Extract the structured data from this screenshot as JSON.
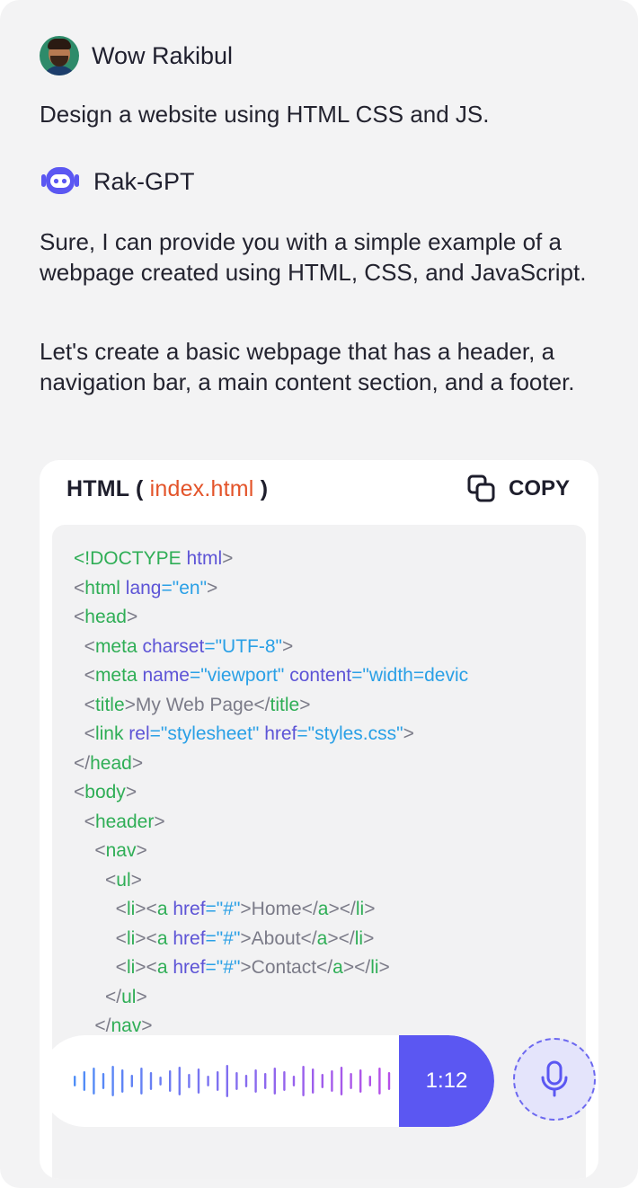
{
  "user": {
    "name": "Wow Rakibul",
    "message": "Design a website using HTML CSS and JS."
  },
  "bot": {
    "name": "Rak-GPT",
    "message_1": "Sure, I can provide you with a simple example of a webpage created using HTML, CSS, and JavaScript.",
    "message_2": "Let's create a basic webpage that has a header, a navigation bar, a main content section, and a footer."
  },
  "code_block": {
    "language": "HTML",
    "filename": "index.html",
    "copy_label": "COPY",
    "lines": [
      [
        {
          "t": "<!",
          "c": "tag"
        },
        {
          "t": "DOCTYPE",
          "c": "tag"
        },
        {
          "t": " html",
          "c": "attr"
        },
        {
          "t": ">",
          "c": "txt"
        }
      ],
      [
        {
          "t": "<",
          "c": "txt"
        },
        {
          "t": "html",
          "c": "tag"
        },
        {
          "t": " lang",
          "c": "attr"
        },
        {
          "t": "=\"en\"",
          "c": "str"
        },
        {
          "t": ">",
          "c": "txt"
        }
      ],
      [
        {
          "t": "<",
          "c": "txt"
        },
        {
          "t": "head",
          "c": "tag"
        },
        {
          "t": ">",
          "c": "txt"
        }
      ],
      [
        {
          "t": "  <",
          "c": "txt"
        },
        {
          "t": "meta",
          "c": "tag"
        },
        {
          "t": " charset",
          "c": "attr"
        },
        {
          "t": "=\"UTF-8\"",
          "c": "str"
        },
        {
          "t": ">",
          "c": "txt"
        }
      ],
      [
        {
          "t": "  <",
          "c": "txt"
        },
        {
          "t": "meta",
          "c": "tag"
        },
        {
          "t": " name",
          "c": "attr"
        },
        {
          "t": "=\"viewport\"",
          "c": "str"
        },
        {
          "t": " content",
          "c": "attr"
        },
        {
          "t": "=\"width=devic",
          "c": "str"
        }
      ],
      [
        {
          "t": "  <",
          "c": "txt"
        },
        {
          "t": "title",
          "c": "tag"
        },
        {
          "t": ">My Web Page</",
          "c": "txt"
        },
        {
          "t": "title",
          "c": "tag"
        },
        {
          "t": ">",
          "c": "txt"
        }
      ],
      [
        {
          "t": "  <",
          "c": "txt"
        },
        {
          "t": "link",
          "c": "tag"
        },
        {
          "t": " rel",
          "c": "attr"
        },
        {
          "t": "=\"stylesheet\"",
          "c": "str"
        },
        {
          "t": " href",
          "c": "attr"
        },
        {
          "t": "=\"styles.css\"",
          "c": "str"
        },
        {
          "t": ">",
          "c": "txt"
        }
      ],
      [
        {
          "t": "</",
          "c": "txt"
        },
        {
          "t": "head",
          "c": "tag"
        },
        {
          "t": ">",
          "c": "txt"
        }
      ],
      [
        {
          "t": "<",
          "c": "txt"
        },
        {
          "t": "body",
          "c": "tag"
        },
        {
          "t": ">",
          "c": "txt"
        }
      ],
      [
        {
          "t": "  <",
          "c": "txt"
        },
        {
          "t": "header",
          "c": "tag"
        },
        {
          "t": ">",
          "c": "txt"
        }
      ],
      [
        {
          "t": "    <",
          "c": "txt"
        },
        {
          "t": "nav",
          "c": "tag"
        },
        {
          "t": ">",
          "c": "txt"
        }
      ],
      [
        {
          "t": "      <",
          "c": "txt"
        },
        {
          "t": "ul",
          "c": "tag"
        },
        {
          "t": ">",
          "c": "txt"
        }
      ],
      [
        {
          "t": "        <",
          "c": "txt"
        },
        {
          "t": "li",
          "c": "tag"
        },
        {
          "t": "><",
          "c": "txt"
        },
        {
          "t": "a",
          "c": "tag"
        },
        {
          "t": " href",
          "c": "attr"
        },
        {
          "t": "=\"#\"",
          "c": "str"
        },
        {
          "t": ">Home</",
          "c": "txt"
        },
        {
          "t": "a",
          "c": "tag"
        },
        {
          "t": "></",
          "c": "txt"
        },
        {
          "t": "li",
          "c": "tag"
        },
        {
          "t": ">",
          "c": "txt"
        }
      ],
      [
        {
          "t": "        <",
          "c": "txt"
        },
        {
          "t": "li",
          "c": "tag"
        },
        {
          "t": "><",
          "c": "txt"
        },
        {
          "t": "a",
          "c": "tag"
        },
        {
          "t": " href",
          "c": "attr"
        },
        {
          "t": "=\"#\"",
          "c": "str"
        },
        {
          "t": ">About</",
          "c": "txt"
        },
        {
          "t": "a",
          "c": "tag"
        },
        {
          "t": "></",
          "c": "txt"
        },
        {
          "t": "li",
          "c": "tag"
        },
        {
          "t": ">",
          "c": "txt"
        }
      ],
      [
        {
          "t": "        <",
          "c": "txt"
        },
        {
          "t": "li",
          "c": "tag"
        },
        {
          "t": "><",
          "c": "txt"
        },
        {
          "t": "a",
          "c": "tag"
        },
        {
          "t": " href",
          "c": "attr"
        },
        {
          "t": "=\"#\"",
          "c": "str"
        },
        {
          "t": ">Contact</",
          "c": "txt"
        },
        {
          "t": "a",
          "c": "tag"
        },
        {
          "t": "></",
          "c": "txt"
        },
        {
          "t": "li",
          "c": "tag"
        },
        {
          "t": ">",
          "c": "txt"
        }
      ],
      [
        {
          "t": "      </",
          "c": "txt"
        },
        {
          "t": "ul",
          "c": "tag"
        },
        {
          "t": ">",
          "c": "txt"
        }
      ],
      [
        {
          "t": "    </",
          "c": "txt"
        },
        {
          "t": "nav",
          "c": "tag"
        },
        {
          "t": ">",
          "c": "txt"
        }
      ]
    ]
  },
  "voice": {
    "duration": "1:12",
    "wave_colors": [
      "#4f8ef7",
      "#b64fe8"
    ]
  },
  "icons": {
    "copy": "copy-icon",
    "mic": "microphone-icon",
    "bot": "bot-icon"
  },
  "colors": {
    "accent": "#5b57f2",
    "filename": "#e3542a",
    "tag": "#2fae56",
    "attr": "#5d54d6",
    "string": "#2aa0e6"
  }
}
